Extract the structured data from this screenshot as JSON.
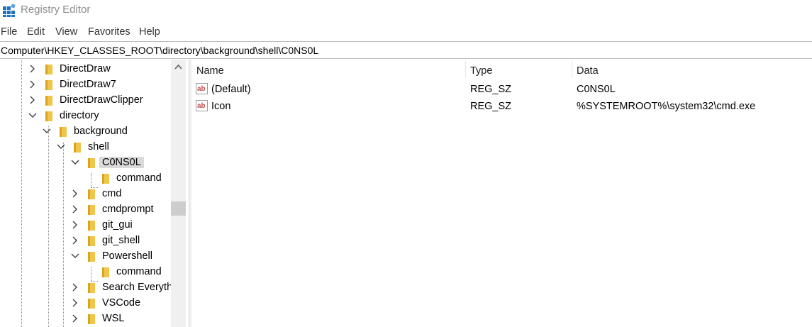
{
  "window": {
    "title": "Registry Editor",
    "app_icon": "registry-editor-icon"
  },
  "menu": {
    "items": [
      "File",
      "Edit",
      "View",
      "Favorites",
      "Help"
    ]
  },
  "address": {
    "path": "Computer\\HKEY_CLASSES_ROOT\\directory\\background\\shell\\C0NS0L"
  },
  "tree": {
    "items": [
      {
        "label": "DirectDraw",
        "level": 0,
        "state": "collapsed"
      },
      {
        "label": "DirectDraw7",
        "level": 0,
        "state": "collapsed"
      },
      {
        "label": "DirectDrawClipper",
        "level": 0,
        "state": "collapsed"
      },
      {
        "label": "directory",
        "level": 0,
        "state": "expanded"
      },
      {
        "label": "background",
        "level": 1,
        "state": "expanded"
      },
      {
        "label": "shell",
        "level": 2,
        "state": "expanded"
      },
      {
        "label": "C0NS0L",
        "level": 3,
        "state": "expanded",
        "selected": true
      },
      {
        "label": "command",
        "level": 4,
        "state": "leaf"
      },
      {
        "label": "cmd",
        "level": 3,
        "state": "collapsed"
      },
      {
        "label": "cmdprompt",
        "level": 3,
        "state": "collapsed"
      },
      {
        "label": "git_gui",
        "level": 3,
        "state": "collapsed"
      },
      {
        "label": "git_shell",
        "level": 3,
        "state": "collapsed"
      },
      {
        "label": "Powershell",
        "level": 3,
        "state": "expanded"
      },
      {
        "label": "command",
        "level": 4,
        "state": "leaf"
      },
      {
        "label": "Search Everything",
        "level": 3,
        "state": "collapsed"
      },
      {
        "label": "VSCode",
        "level": 3,
        "state": "collapsed"
      },
      {
        "label": "WSL",
        "level": 3,
        "state": "collapsed"
      }
    ]
  },
  "values": {
    "columns": [
      "Name",
      "Type",
      "Data"
    ],
    "rows": [
      {
        "icon": "string-value-icon",
        "name": "(Default)",
        "type": "REG_SZ",
        "data": "C0NS0L"
      },
      {
        "icon": "string-value-icon",
        "name": "Icon",
        "type": "REG_SZ",
        "data": "%SYSTEMROOT%\\system32\\cmd.exe"
      }
    ]
  },
  "colors": {
    "folder": "#f0c64a",
    "selection": "#d9d9d9",
    "ab_icon_red": "#c0504d"
  }
}
